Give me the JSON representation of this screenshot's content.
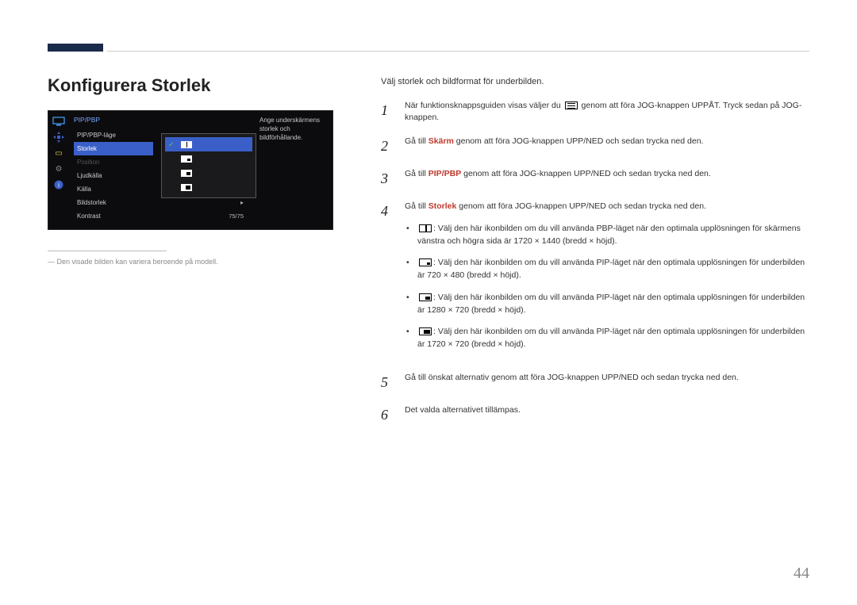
{
  "title": "Konfigurera Storlek",
  "osd": {
    "header": "PIP/PBP",
    "items": {
      "mode": "PIP/PBP-läge",
      "size": "Storlek",
      "position": "Position",
      "sound": "Ljudkälla",
      "source": "Källa",
      "aspect": "Bildstorlek",
      "contrast": "Kontrast",
      "contrast_value": "75/75"
    },
    "help": "Ange underskärmens storlek och bildförhållande."
  },
  "footnote": "Den visade bilden kan variera beroende på modell.",
  "intro": "Välj storlek och bildformat för underbilden.",
  "steps": {
    "s1_a": "När funktionsknappsguiden visas väljer du ",
    "s1_b": " genom att föra JOG-knappen UPPÅT. Tryck sedan på JOG-knappen.",
    "s2_a": "Gå till ",
    "s2_bold": "Skärm",
    "s2_b": " genom att föra JOG-knappen UPP/NED och sedan trycka ned den.",
    "s3_a": "Gå till ",
    "s3_bold": "PIP/PBP",
    "s3_b": " genom att föra JOG-knappen UPP/NED och sedan trycka ned den.",
    "s4_a": "Gå till ",
    "s4_bold": "Storlek",
    "s4_b": " genom att föra JOG-knappen UPP/NED och sedan trycka ned den.",
    "li1": ": Välj den här ikonbilden om du vill använda PBP-läget när den optimala upplösningen för skärmens vänstra och högra sida är 1720 × 1440 (bredd × höjd).",
    "li2": ": Välj den här ikonbilden om du vill använda PIP-läget när den optimala upplösningen för underbilden är 720 × 480 (bredd × höjd).",
    "li3": ": Välj den här ikonbilden om du vill använda PIP-läget när den optimala upplösningen för underbilden är 1280 × 720 (bredd × höjd).",
    "li4": ": Välj den här ikonbilden om du vill använda PIP-läget när den optimala upplösningen för underbilden är 1720 × 720 (bredd × höjd).",
    "s5": "Gå till önskat alternativ genom att föra JOG-knappen UPP/NED och sedan trycka ned den.",
    "s6": "Det valda alternativet tillämpas."
  },
  "page_number": "44"
}
